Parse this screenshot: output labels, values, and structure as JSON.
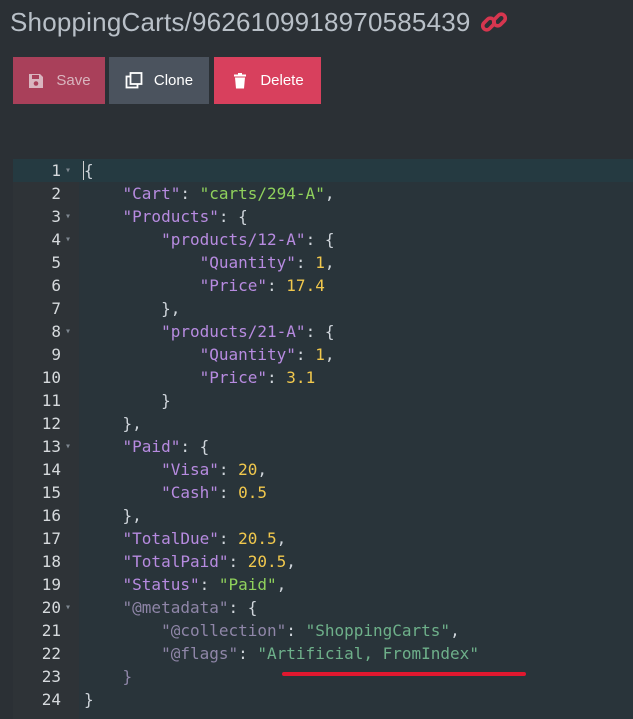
{
  "header": {
    "title": "ShoppingCarts/9626109918970585439",
    "link_icon": "link-icon",
    "link_color": "#d6364f"
  },
  "toolbar": {
    "save_label": "Save",
    "clone_label": "Clone",
    "delete_label": "Delete"
  },
  "editor": {
    "lines": [
      {
        "n": "1",
        "fold": true,
        "code": [
          {
            "t": "{",
            "c": "p"
          }
        ]
      },
      {
        "n": "2",
        "fold": false,
        "code": [
          {
            "t": "    ",
            "c": "p"
          },
          {
            "t": "\"Cart\"",
            "c": "k"
          },
          {
            "t": ": ",
            "c": "p"
          },
          {
            "t": "\"carts/294-A\"",
            "c": "s"
          },
          {
            "t": ",",
            "c": "p"
          }
        ]
      },
      {
        "n": "3",
        "fold": true,
        "code": [
          {
            "t": "    ",
            "c": "p"
          },
          {
            "t": "\"Products\"",
            "c": "k"
          },
          {
            "t": ": {",
            "c": "p"
          }
        ]
      },
      {
        "n": "4",
        "fold": true,
        "code": [
          {
            "t": "        ",
            "c": "p"
          },
          {
            "t": "\"products/12-A\"",
            "c": "k"
          },
          {
            "t": ": {",
            "c": "p"
          }
        ]
      },
      {
        "n": "5",
        "fold": false,
        "code": [
          {
            "t": "            ",
            "c": "p"
          },
          {
            "t": "\"Quantity\"",
            "c": "k"
          },
          {
            "t": ": ",
            "c": "p"
          },
          {
            "t": "1",
            "c": "n"
          },
          {
            "t": ",",
            "c": "p"
          }
        ]
      },
      {
        "n": "6",
        "fold": false,
        "code": [
          {
            "t": "            ",
            "c": "p"
          },
          {
            "t": "\"Price\"",
            "c": "k"
          },
          {
            "t": ": ",
            "c": "p"
          },
          {
            "t": "17.4",
            "c": "n"
          }
        ]
      },
      {
        "n": "7",
        "fold": false,
        "code": [
          {
            "t": "        },",
            "c": "p"
          }
        ]
      },
      {
        "n": "8",
        "fold": true,
        "code": [
          {
            "t": "        ",
            "c": "p"
          },
          {
            "t": "\"products/21-A\"",
            "c": "k"
          },
          {
            "t": ": {",
            "c": "p"
          }
        ]
      },
      {
        "n": "9",
        "fold": false,
        "code": [
          {
            "t": "            ",
            "c": "p"
          },
          {
            "t": "\"Quantity\"",
            "c": "k"
          },
          {
            "t": ": ",
            "c": "p"
          },
          {
            "t": "1",
            "c": "n"
          },
          {
            "t": ",",
            "c": "p"
          }
        ]
      },
      {
        "n": "10",
        "fold": false,
        "code": [
          {
            "t": "            ",
            "c": "p"
          },
          {
            "t": "\"Price\"",
            "c": "k"
          },
          {
            "t": ": ",
            "c": "p"
          },
          {
            "t": "3.1",
            "c": "n"
          }
        ]
      },
      {
        "n": "11",
        "fold": false,
        "code": [
          {
            "t": "        }",
            "c": "p"
          }
        ]
      },
      {
        "n": "12",
        "fold": false,
        "code": [
          {
            "t": "    },",
            "c": "p"
          }
        ]
      },
      {
        "n": "13",
        "fold": true,
        "code": [
          {
            "t": "    ",
            "c": "p"
          },
          {
            "t": "\"Paid\"",
            "c": "k"
          },
          {
            "t": ": {",
            "c": "p"
          }
        ]
      },
      {
        "n": "14",
        "fold": false,
        "code": [
          {
            "t": "        ",
            "c": "p"
          },
          {
            "t": "\"Visa\"",
            "c": "k"
          },
          {
            "t": ": ",
            "c": "p"
          },
          {
            "t": "20",
            "c": "n"
          },
          {
            "t": ",",
            "c": "p"
          }
        ]
      },
      {
        "n": "15",
        "fold": false,
        "code": [
          {
            "t": "        ",
            "c": "p"
          },
          {
            "t": "\"Cash\"",
            "c": "k"
          },
          {
            "t": ": ",
            "c": "p"
          },
          {
            "t": "0.5",
            "c": "n"
          }
        ]
      },
      {
        "n": "16",
        "fold": false,
        "code": [
          {
            "t": "    },",
            "c": "p"
          }
        ]
      },
      {
        "n": "17",
        "fold": false,
        "code": [
          {
            "t": "    ",
            "c": "p"
          },
          {
            "t": "\"TotalDue\"",
            "c": "k"
          },
          {
            "t": ": ",
            "c": "p"
          },
          {
            "t": "20.5",
            "c": "n"
          },
          {
            "t": ",",
            "c": "p"
          }
        ]
      },
      {
        "n": "18",
        "fold": false,
        "code": [
          {
            "t": "    ",
            "c": "p"
          },
          {
            "t": "\"TotalPaid\"",
            "c": "k"
          },
          {
            "t": ": ",
            "c": "p"
          },
          {
            "t": "20.5",
            "c": "n"
          },
          {
            "t": ",",
            "c": "p"
          }
        ]
      },
      {
        "n": "19",
        "fold": false,
        "code": [
          {
            "t": "    ",
            "c": "p"
          },
          {
            "t": "\"Status\"",
            "c": "k"
          },
          {
            "t": ": ",
            "c": "p"
          },
          {
            "t": "\"Paid\"",
            "c": "s"
          },
          {
            "t": ",",
            "c": "p"
          }
        ]
      },
      {
        "n": "20",
        "fold": true,
        "code": [
          {
            "t": "    ",
            "c": "p"
          },
          {
            "t": "\"@metadata\"",
            "c": "mk"
          },
          {
            "t": ": {",
            "c": "p"
          }
        ]
      },
      {
        "n": "21",
        "fold": false,
        "code": [
          {
            "t": "        ",
            "c": "p"
          },
          {
            "t": "\"@collection\"",
            "c": "mk"
          },
          {
            "t": ": ",
            "c": "p"
          },
          {
            "t": "\"ShoppingCarts\"",
            "c": "ms"
          },
          {
            "t": ",",
            "c": "p"
          }
        ]
      },
      {
        "n": "22",
        "fold": false,
        "code": [
          {
            "t": "        ",
            "c": "p"
          },
          {
            "t": "\"@flags\"",
            "c": "mk"
          },
          {
            "t": ": ",
            "c": "p"
          },
          {
            "t": "\"Artificial, FromIndex\"",
            "c": "ms"
          }
        ]
      },
      {
        "n": "23",
        "fold": false,
        "code": [
          {
            "t": "    }",
            "c": "mk"
          }
        ]
      },
      {
        "n": "24",
        "fold": false,
        "code": [
          {
            "t": "}",
            "c": "p"
          }
        ]
      }
    ]
  },
  "annotation": {
    "underline_color": "#e0182f"
  }
}
